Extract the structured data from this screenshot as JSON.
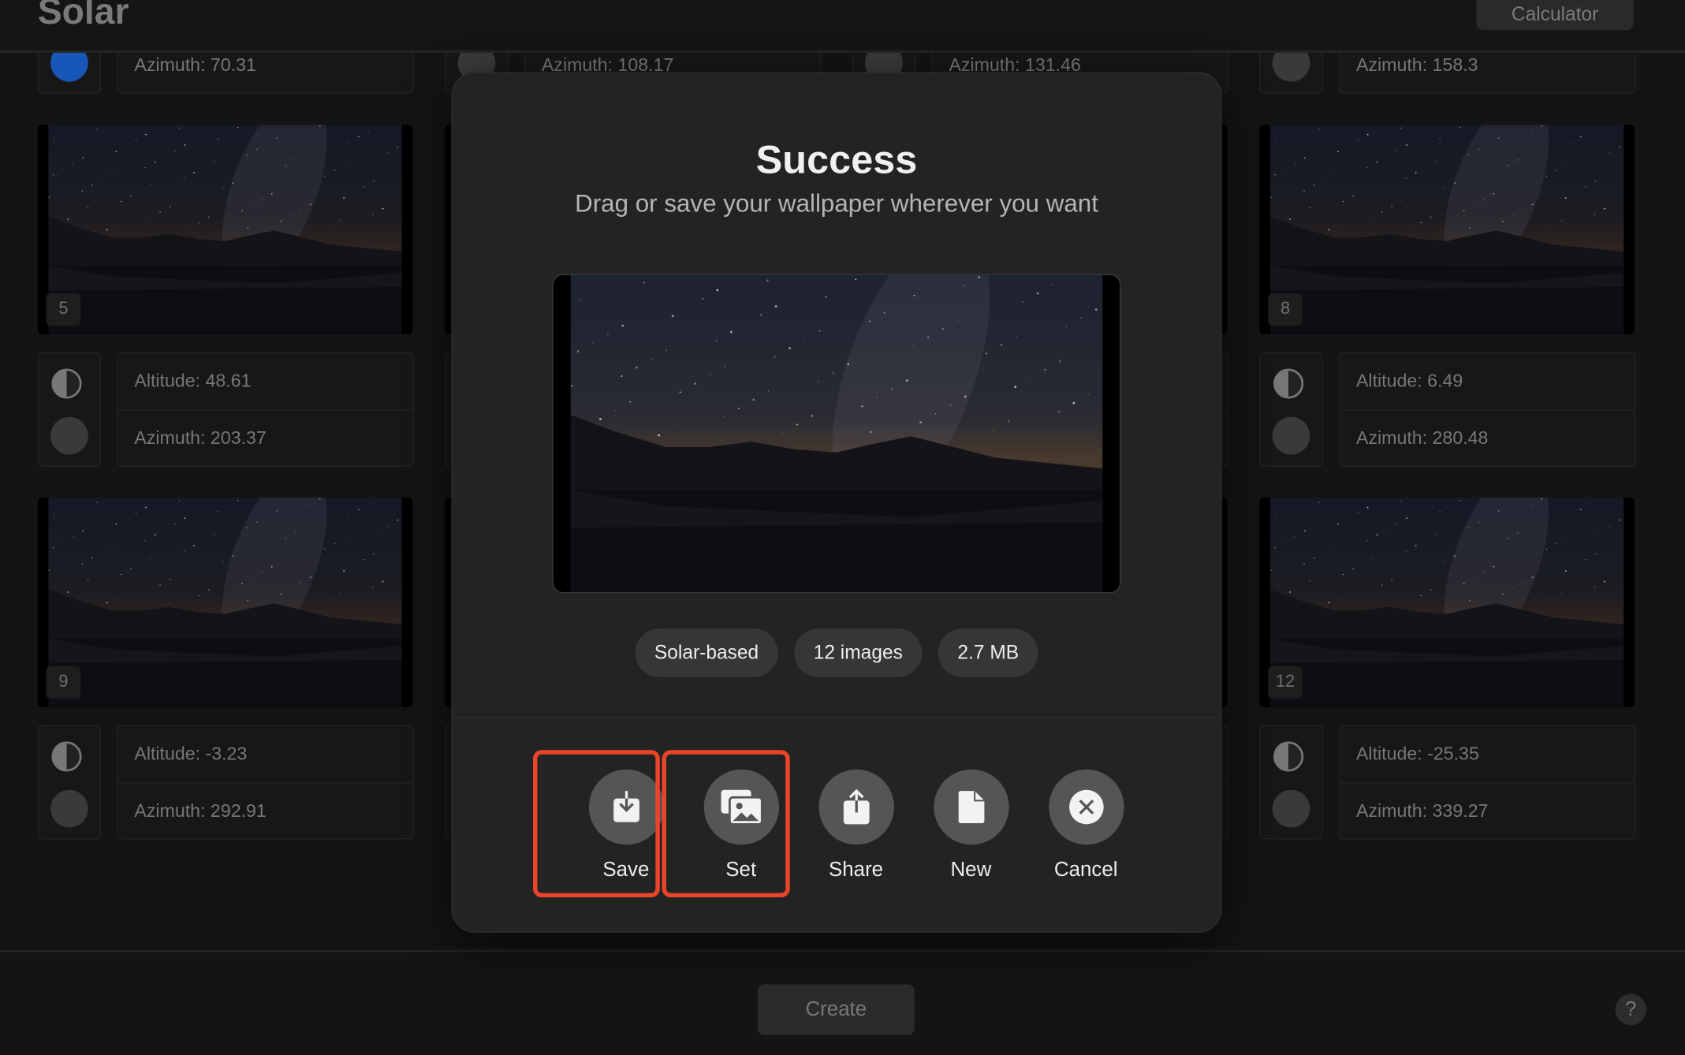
{
  "header": {
    "title": "Solar",
    "calculator_label": "Calculator"
  },
  "tiles_top_row": [
    {
      "azimuth": "Azimuth:  70.31",
      "active": true
    },
    {
      "azimuth": "Azimuth:  108.17",
      "active": false
    },
    {
      "azimuth": "Azimuth:  131.46",
      "active": false
    },
    {
      "azimuth": "Azimuth:  158.3",
      "active": false
    }
  ],
  "tiles": [
    {
      "number": "5",
      "altitude": "Altitude:  48.61",
      "azimuth": "Azimuth:  203.37"
    },
    {
      "number": "",
      "altitude": "",
      "azimuth": ""
    },
    {
      "number": "",
      "altitude": "",
      "azimuth": ""
    },
    {
      "number": "8",
      "altitude": "Altitude:  6.49",
      "azimuth": "Azimuth:  280.48"
    },
    {
      "number": "9",
      "altitude": "Altitude:  -3.23",
      "azimuth": "Azimuth:  292.91"
    },
    {
      "number": "",
      "altitude": "",
      "azimuth": ""
    },
    {
      "number": "",
      "altitude": "",
      "azimuth": ""
    },
    {
      "number": "12",
      "altitude": "Altitude:  -25.35",
      "azimuth": "Azimuth:  339.27"
    }
  ],
  "modal": {
    "title": "Success",
    "subtitle": "Drag or save your wallpaper wherever you want",
    "chips": [
      "Solar-based",
      "12 images",
      "2.7 MB"
    ],
    "actions": [
      {
        "label": "Save",
        "icon": "save-download-icon",
        "highlighted": true
      },
      {
        "label": "Set",
        "icon": "set-wallpaper-icon",
        "highlighted": true
      },
      {
        "label": "Share",
        "icon": "share-icon",
        "highlighted": false
      },
      {
        "label": "New",
        "icon": "new-document-icon",
        "highlighted": false
      },
      {
        "label": "Cancel",
        "icon": "cancel-x-icon",
        "highlighted": false
      }
    ]
  },
  "footer": {
    "create_label": "Create",
    "help_label": "?"
  },
  "colors": {
    "highlight": "#e8452a",
    "accent": "#1856b8"
  }
}
